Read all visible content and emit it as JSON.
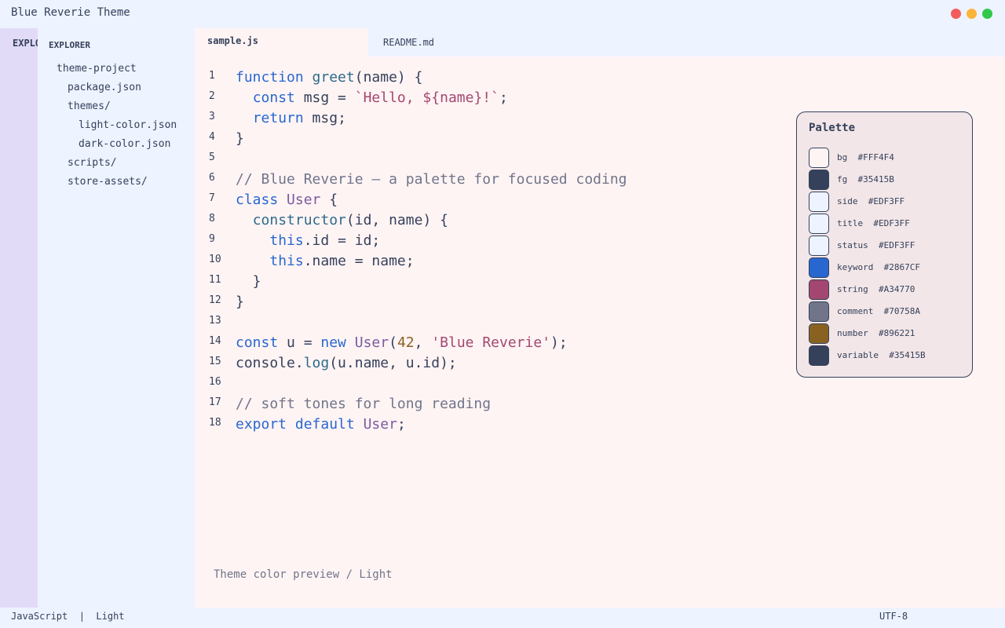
{
  "window": {
    "title": "Blue Reverie Theme",
    "controls": [
      {
        "name": "close",
        "color": "#F55B5B"
      },
      {
        "name": "minimize",
        "color": "#FBB53B"
      },
      {
        "name": "maximize",
        "color": "#31C74A"
      }
    ]
  },
  "activity_bar": {
    "label": "EXPLORER"
  },
  "sidebar": {
    "title": "EXPLORER",
    "tree": [
      {
        "label": "theme-project",
        "depth": 0
      },
      {
        "label": "package.json",
        "depth": 1
      },
      {
        "label": "themes/",
        "depth": 1
      },
      {
        "label": "light-color.json",
        "depth": 2
      },
      {
        "label": "dark-color.json",
        "depth": 2
      },
      {
        "label": "scripts/",
        "depth": 1
      },
      {
        "label": "store-assets/",
        "depth": 1
      }
    ]
  },
  "tabs": [
    {
      "label": "sample.js",
      "active": true
    },
    {
      "label": "README.md",
      "active": false
    }
  ],
  "code_lines": [
    "function greet(name) {",
    "  const msg = `Hello, ${name}!`;",
    "  return msg;",
    "}",
    "",
    "// Blue Reverie — a palette for focused coding",
    "class User {",
    "  constructor(id, name) {",
    "    this.id = id;",
    "    this.name = name;",
    "  }",
    "}",
    "",
    "const u = new User(42, 'Blue Reverie');",
    "console.log(u.name, u.id);",
    "",
    "// soft tones for long reading",
    "export default User;"
  ],
  "line_numbers": [
    "1",
    "2",
    "3",
    "4",
    "5",
    "6",
    "7",
    "8",
    "9",
    "10",
    "11",
    "12",
    "13",
    "14",
    "15",
    "16",
    "17",
    "18"
  ],
  "footer_note": "Theme color preview / Light",
  "palette": {
    "title": "Palette",
    "swatches": [
      {
        "name": "bg",
        "hex": "#FFF4F4"
      },
      {
        "name": "fg",
        "hex": "#35415B"
      },
      {
        "name": "side",
        "hex": "#EDF3FF"
      },
      {
        "name": "title",
        "hex": "#EDF3FF"
      },
      {
        "name": "status",
        "hex": "#EDF3FF"
      },
      {
        "name": "keyword",
        "hex": "#2867CF"
      },
      {
        "name": "string",
        "hex": "#A34770"
      },
      {
        "name": "comment",
        "hex": "#70758A"
      },
      {
        "name": "number",
        "hex": "#896221"
      },
      {
        "name": "variable",
        "hex": "#35415B"
      }
    ]
  },
  "status_bar": {
    "language": "JavaScript",
    "separator": "|",
    "theme": "Light",
    "encoding": "UTF-8"
  }
}
